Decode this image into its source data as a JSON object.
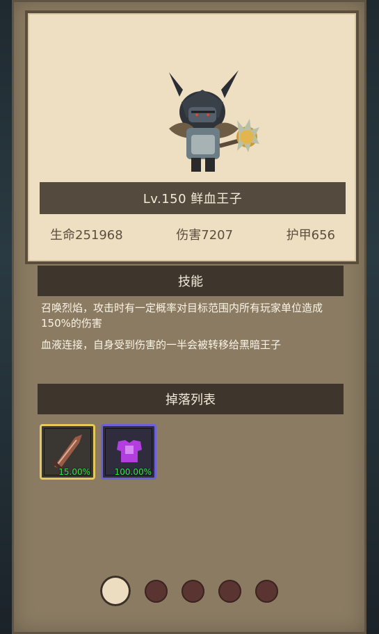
{
  "monster": {
    "level_name": "Lv.150 鲜血王子",
    "stats": {
      "hp": "生命251968",
      "damage": "伤害7207",
      "armor": "护甲656"
    },
    "portrait_icon": "dark-horned-warrior-with-axe"
  },
  "skills": {
    "title": "技能",
    "lines": [
      "召唤烈焰，攻击时有一定概率对目标范围内所有玩家单位造成150%的伤害",
      "血液连接，自身受到伤害的一半会被转移给黑暗王子"
    ]
  },
  "drops": {
    "title": "掉落列表",
    "items": [
      {
        "icon": "bone-sword-icon",
        "rate": "15.00%",
        "rarity_color": "#e6c95b"
      },
      {
        "icon": "purple-armor-icon",
        "rate": "100.00%",
        "rarity_color": "#6b61d8"
      }
    ]
  },
  "pagination": {
    "total": 5,
    "active_index": 0
  }
}
